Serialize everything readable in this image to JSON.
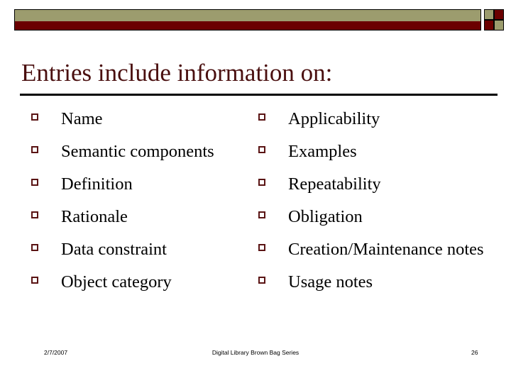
{
  "slide": {
    "title": "Entries include information on:",
    "title_color": "#4a0f0f",
    "bullet_color": "#5a1414",
    "banner_tan": "#9c9c6e",
    "banner_red": "#6b0000"
  },
  "columns": {
    "left": [
      {
        "label": "Name"
      },
      {
        "label": "Semantic components"
      },
      {
        "label": "Definition"
      },
      {
        "label": "Rationale"
      },
      {
        "label": "Data constraint"
      },
      {
        "label": "Object category"
      }
    ],
    "right": [
      {
        "label": "Applicability"
      },
      {
        "label": "Examples"
      },
      {
        "label": "Repeatability"
      },
      {
        "label": "Obligation"
      },
      {
        "label": "Creation/Maintenance notes"
      },
      {
        "label": "Usage notes"
      }
    ]
  },
  "footer": {
    "date": "2/7/2007",
    "center": "Digital Library Brown Bag Series",
    "page": "26"
  }
}
